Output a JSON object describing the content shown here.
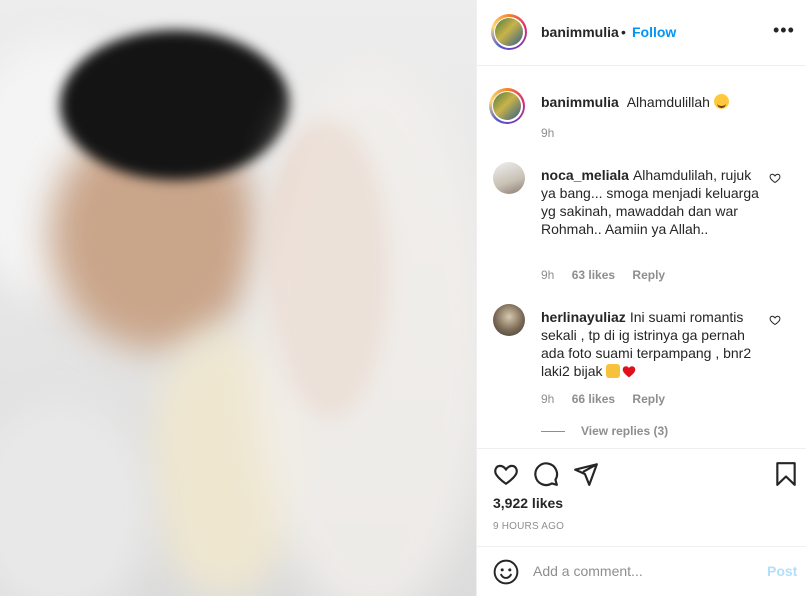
{
  "post": {
    "username": "banimmulia",
    "follow_label": "Follow",
    "separator": "•",
    "more_label": "•••",
    "caption": "Alhamdulillah",
    "caption_emoji": "smiling-face-with-hearts",
    "caption_time": "9h",
    "likes": "3,922 likes",
    "posted_ago": "9 HOURS AGO"
  },
  "comments": [
    {
      "username": "noca_meliala",
      "text": "Alhamdulilah, rujuk ya bang... smoga menjadi keluarga yg sakinah, mawaddah dan war Rohmah.. Aamiin ya Allah..",
      "time": "9h",
      "likes": "63 likes",
      "reply_label": "Reply"
    },
    {
      "username": "herlinayuliaz",
      "text": "Ini suami romantis sekali , tp di ig istrinya ga pernah ada foto suami terpampang , bnr2 laki2 bijak",
      "emojis": [
        "clapping-hands",
        "red-heart"
      ],
      "time": "9h",
      "likes": "66 likes",
      "reply_label": "Reply"
    }
  ],
  "view_replies": "View replies (3)",
  "add_comment": {
    "placeholder": "Add a comment...",
    "post_label": "Post"
  },
  "colors": {
    "accent": "#0095f6",
    "text": "#262626",
    "muted": "#8e8e8e",
    "post_disabled": "#b2dffc",
    "heart": "#ed4956"
  },
  "icons": [
    "more-icon",
    "like-heart-icon",
    "comment-icon",
    "share-icon",
    "save-bookmark-icon",
    "emoji-smile-icon"
  ]
}
